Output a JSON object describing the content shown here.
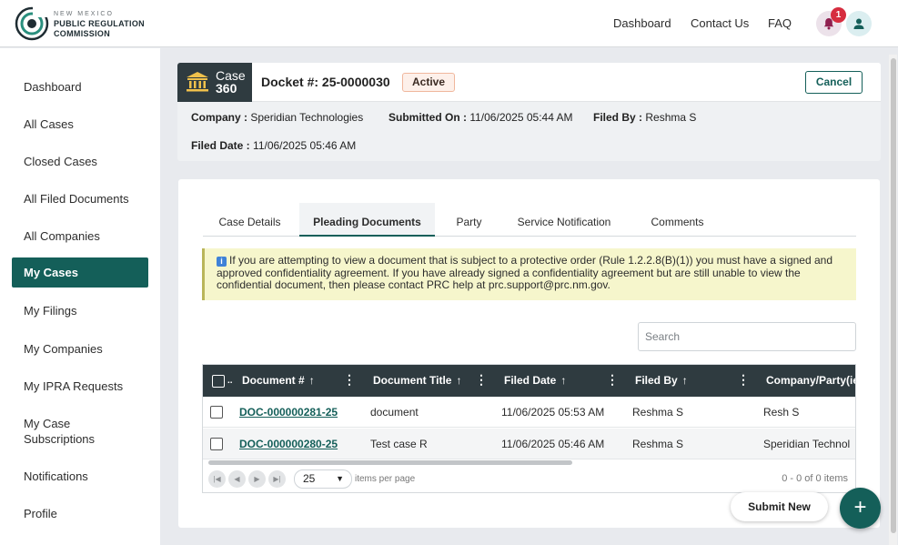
{
  "header": {
    "logo_line1": "NEW MEXICO",
    "logo_line2": "PUBLIC REGULATION",
    "logo_line3": "COMMISSION",
    "nav": [
      "Dashboard",
      "Contact Us",
      "FAQ"
    ],
    "notification_count": "1",
    "icons": [
      "bell-icon",
      "user-icon"
    ]
  },
  "sidebar": {
    "items": [
      {
        "label": "Dashboard"
      },
      {
        "label": "All Cases"
      },
      {
        "label": "Closed Cases"
      },
      {
        "label": "All Filed Documents"
      },
      {
        "label": "All Companies"
      },
      {
        "label": "My Cases",
        "active": true
      },
      {
        "label": "My Filings"
      },
      {
        "label": "My Companies"
      },
      {
        "label": "My IPRA Requests"
      },
      {
        "label": "My Case Subscriptions"
      },
      {
        "label": "Notifications"
      },
      {
        "label": "Profile"
      }
    ]
  },
  "case": {
    "badge_line1": "Case",
    "badge_line2": "360",
    "docket": "Docket #: 25-0000030",
    "status": "Active",
    "cancel_label": "Cancel",
    "company_label": "Company :",
    "company": "Speridian Technologies",
    "submitted_label": "Submitted On :",
    "submitted": "11/06/2025 05:44 AM",
    "filed_by_label": "Filed By :",
    "filed_by": "Reshma S",
    "filed_date_label": "Filed Date :",
    "filed_date": "11/06/2025 05:46 AM"
  },
  "tabs": [
    {
      "label": "Case Details"
    },
    {
      "label": "Pleading Documents",
      "active": true
    },
    {
      "label": "Party"
    },
    {
      "label": "Service Notification"
    },
    {
      "label": "Comments"
    }
  ],
  "notice": {
    "text": "If you are attempting to view a document that is subject to a protective order (Rule 1.2.2.8(B)(1)) you must have a signed and approved confidentiality agreement. If you have already signed a confidentiality agreement but are still unable to view the confidential document, then please contact PRC help at prc.support@prc.nm.gov."
  },
  "search": {
    "placeholder": "Search",
    "value": ""
  },
  "grid": {
    "columns": [
      "Document #",
      "Document Title",
      "Filed Date",
      "Filed By",
      "Company/Party(ies"
    ],
    "sort_arrow": "↑",
    "rows": [
      {
        "doc": "DOC-000000281-25",
        "title": "document",
        "date": "11/06/2025 05:53 AM",
        "by": "Reshma S",
        "company": "Resh S"
      },
      {
        "doc": "DOC-000000280-25",
        "title": "Test case R",
        "date": "11/06/2025 05:46 AM",
        "by": "Reshma S",
        "company": "Speridian Technol"
      }
    ],
    "page_size": "25",
    "items_per_page": "items per page",
    "range": "0 - 0 of 0 items"
  },
  "actions": {
    "submit_new": "Submit New",
    "fab": "+"
  },
  "colors": {
    "primary": "#145f59",
    "header_dark": "#2f3b40",
    "notice_bg": "#f6f6cc",
    "status_border": "#f0b79d",
    "badge": "#d62d3f"
  }
}
